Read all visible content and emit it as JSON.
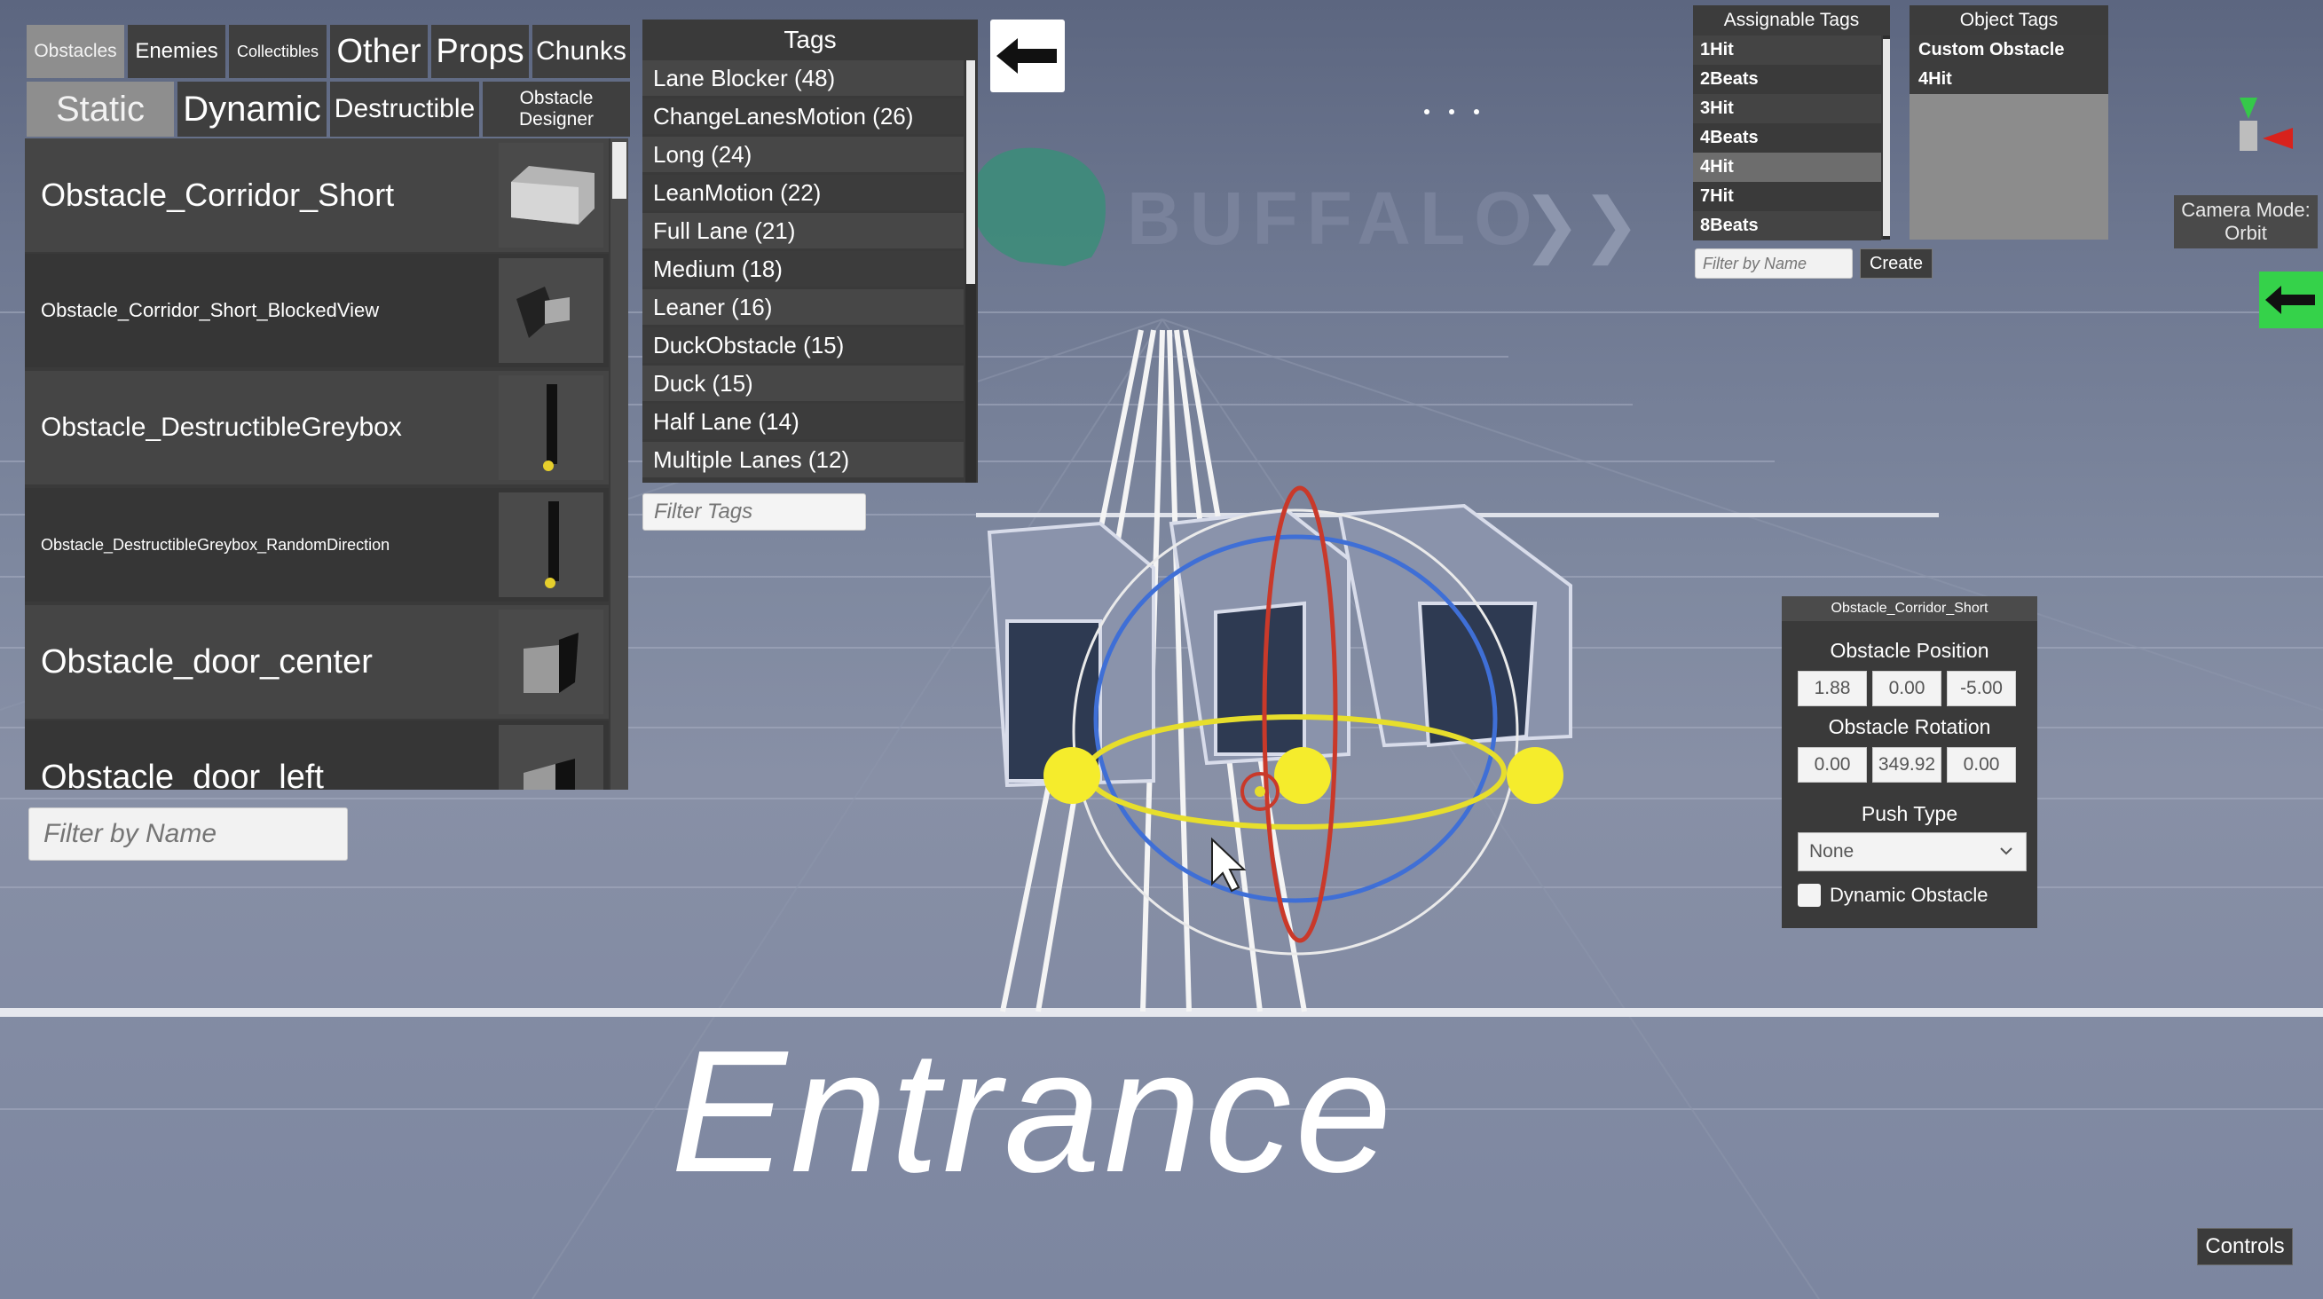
{
  "tabs": {
    "row1": [
      "Obstacles",
      "Enemies",
      "Collectibles",
      "Other",
      "Props",
      "Chunks"
    ],
    "row2": [
      "Static",
      "Dynamic",
      "Destructible",
      "Obstacle Designer"
    ]
  },
  "assets": [
    "Obstacle_Corridor_Short",
    "Obstacle_Corridor_Short_BlockedView",
    "Obstacle_DestructibleGreybox",
    "Obstacle_DestructibleGreybox_RandomDirection",
    "Obstacle_door_center",
    "Obstacle_door_left"
  ],
  "filter_name_placeholder": "Filter by Name",
  "tags": {
    "title": "Tags",
    "items": [
      "Lane Blocker (48)",
      "ChangeLanesMotion (26)",
      "Long (24)",
      "LeanMotion (22)",
      "Full Lane (21)",
      "Medium (18)",
      "Leaner (16)",
      "DuckObstacle (15)",
      "Duck (15)",
      "Half Lane (14)",
      "Multiple Lanes (12)"
    ],
    "filter_placeholder": "Filter Tags"
  },
  "assignable_tags": {
    "title": "Assignable Tags",
    "items": [
      "1Hit",
      "2Beats",
      "3Hit",
      "4Beats",
      "4Hit",
      "7Hit",
      "8Beats"
    ],
    "selected": "4Hit",
    "filter_placeholder": "Filter by Name",
    "create_label": "Create"
  },
  "object_tags": {
    "title": "Object Tags",
    "items": [
      "Custom Obstacle",
      "4Hit"
    ]
  },
  "camera_mode": {
    "line1": "Camera Mode:",
    "line2": "Orbit"
  },
  "inspector": {
    "title": "Obstacle_Corridor_Short",
    "position_label": "Obstacle Position",
    "position": [
      "1.88",
      "0.00",
      "-5.00"
    ],
    "rotation_label": "Obstacle Rotation",
    "rotation": [
      "0.00",
      "349.92",
      "0.00"
    ],
    "push_type_label": "Push Type",
    "push_type_value": "None",
    "dynamic_label": "Dynamic Obstacle",
    "dynamic_checked": false
  },
  "controls_label": "Controls",
  "scene": {
    "entrance_text": "Entrance",
    "billboard_text": "BUFFALO"
  },
  "icons": [
    "arrow-left-icon",
    "chevron-down-icon",
    "cursor-icon",
    "axis-gizmo-icon"
  ]
}
